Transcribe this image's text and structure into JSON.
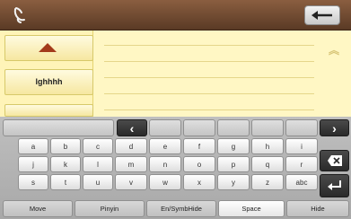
{
  "colors": {
    "topbar": "#5a3a25",
    "candidate_bg": "#fff4b8",
    "arrow_red": "#a33a1a",
    "keyboard_bg": "#b3b3b3",
    "dark_key": "#2e2e2e"
  },
  "topbar": {
    "left_icon": "recognition-hand-icon",
    "right_icon": "backspace-arrow-icon"
  },
  "candidates": {
    "up_icon": "up-triangle-icon",
    "word": "lghhhh",
    "scroll_icon": "double-chevron-up-icon"
  },
  "keyboard": {
    "row1_nav": {
      "left": "‹",
      "right": "›"
    },
    "row2": [
      "a",
      "b",
      "c",
      "d",
      "e",
      "f",
      "g",
      "h",
      "i"
    ],
    "row3": [
      "j",
      "k",
      "l",
      "m",
      "n",
      "o",
      "p",
      "q",
      "r"
    ],
    "row4": [
      "s",
      "t",
      "u",
      "v",
      "w",
      "x",
      "y",
      "z",
      "abc"
    ],
    "side_icons": [
      "close-icon",
      "enter-icon"
    ],
    "bottom": {
      "move": "Move",
      "pinyin": "Pinyin",
      "en_symb_hide": "En/SymbHide",
      "space": "Space",
      "hide": "Hide"
    }
  }
}
